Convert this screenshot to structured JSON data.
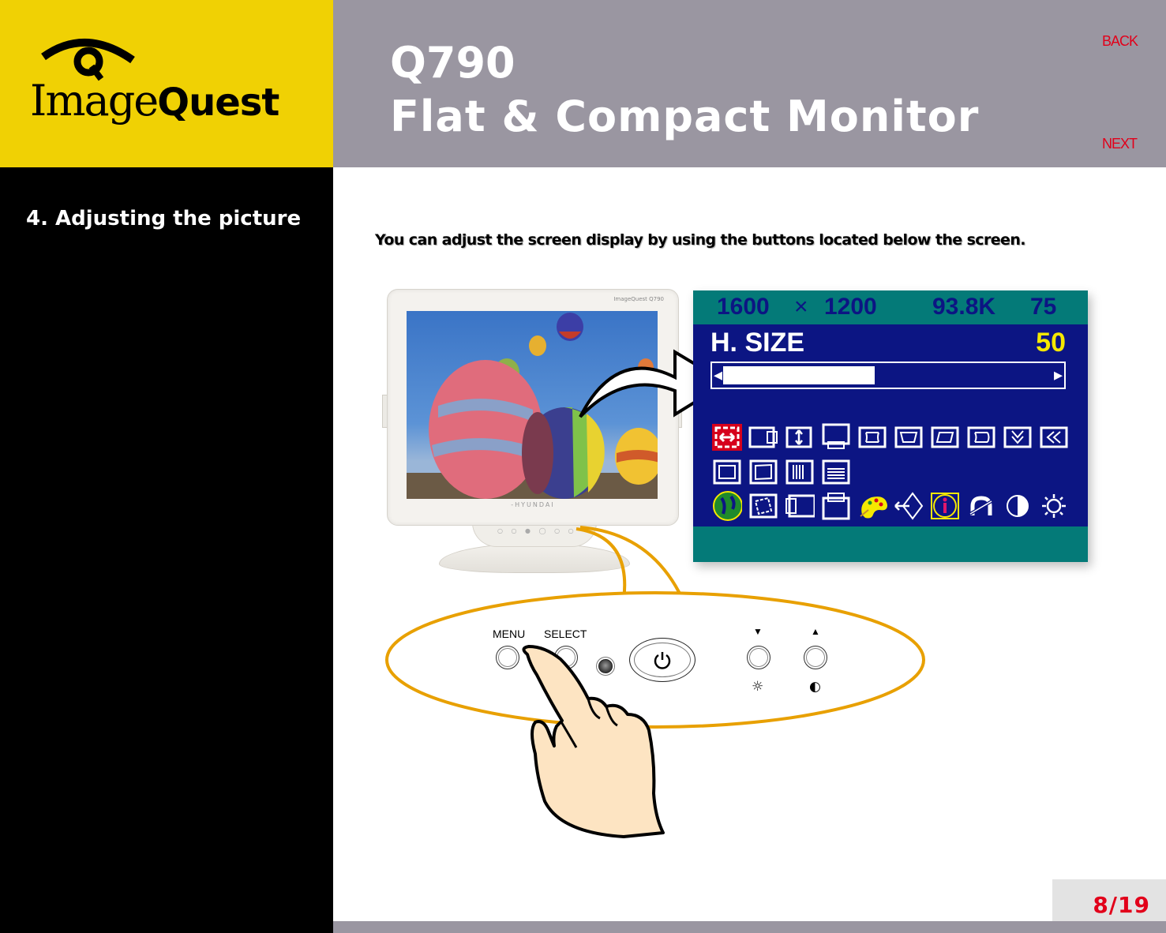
{
  "brand": {
    "logo_text_light": "Image",
    "logo_text_bold": "Quest",
    "colors": {
      "yellow": "#f0d104",
      "gray": "#9a96a1",
      "red": "#e2001a"
    }
  },
  "header": {
    "model": "Q790",
    "product": "Flat & Compact Monitor",
    "back_label": "BACK",
    "next_label": "NEXT"
  },
  "sidebar": {
    "section_title": "4. Adjusting the picture"
  },
  "main": {
    "intro": "You can adjust the screen display by using the buttons located below the screen."
  },
  "monitor": {
    "brand_label": "-HYUNDAI",
    "corner_logo": "ImageQuest Q790"
  },
  "osd": {
    "resolution_w": "1600",
    "times": "×",
    "resolution_h": "1200",
    "h_freq": "93.8K",
    "v_freq": "75",
    "item_label": "H. SIZE",
    "item_value": "50",
    "slider_fraction": 0.5,
    "colors": {
      "panel": "#0c1583",
      "bar": "#047a78",
      "value": "#f5e800",
      "selected": "#d6001c"
    },
    "icon_rows": [
      [
        "h-size",
        "h-position",
        "v-size",
        "v-position",
        "pincushion",
        "trapezoid",
        "parallelogram",
        "pin-balance",
        "v-moire",
        "h-moire"
      ],
      [
        "rotation",
        "tilt",
        "h-convergence",
        "v-convergence"
      ],
      [
        "language",
        "osd-rotation",
        "osd-h-position",
        "osd-v-position",
        "color-temperature",
        "input-select",
        "information",
        "degauss",
        "contrast",
        "brightness"
      ]
    ],
    "selected_icon": "h-size"
  },
  "controls": {
    "menu_label": "MENU",
    "select_label": "SELECT",
    "down_label": "▼",
    "up_label": "▲",
    "brightness_symbol": "☼",
    "contrast_symbol": "◐",
    "power_symbol": "⏻"
  },
  "footer": {
    "page": "8/19"
  }
}
